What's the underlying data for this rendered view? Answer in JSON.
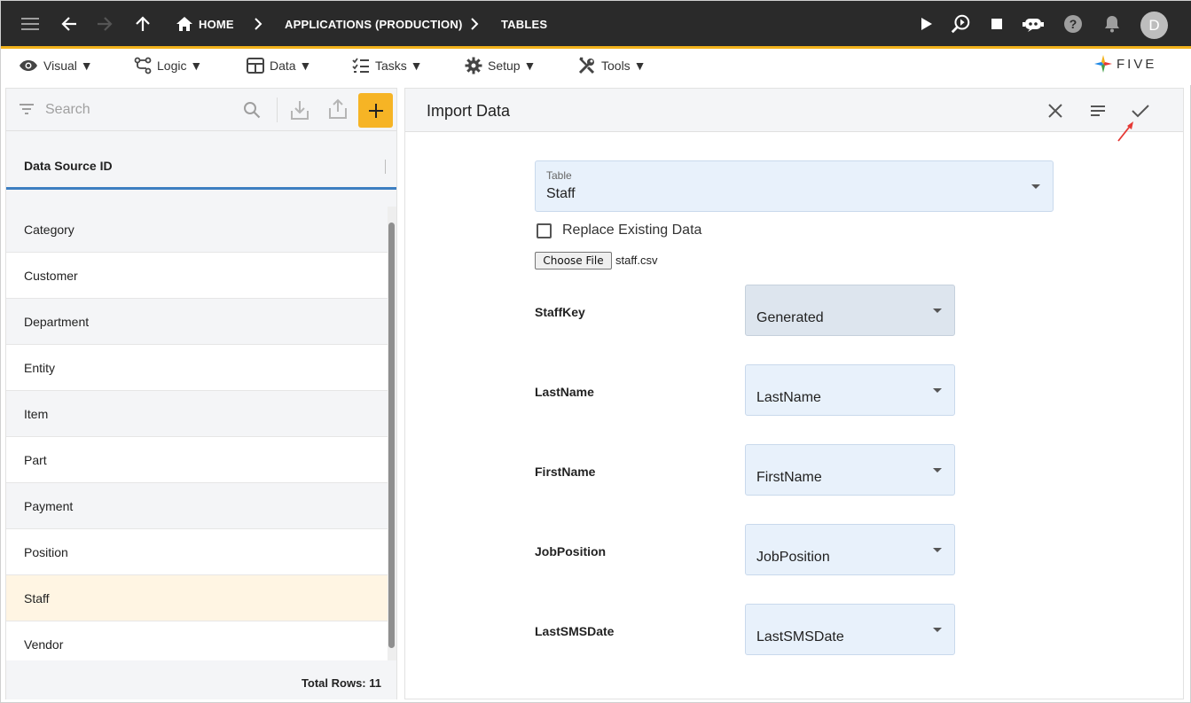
{
  "topbar": {
    "breadcrumbs": [
      "HOME",
      "APPLICATIONS (PRODUCTION)",
      "TABLES"
    ],
    "avatar_letter": "D"
  },
  "menu": {
    "items": [
      {
        "label": "Visual ▼",
        "icon": "eye-icon"
      },
      {
        "label": "Logic ▼",
        "icon": "logic-icon"
      },
      {
        "label": "Data ▼",
        "icon": "table-icon"
      },
      {
        "label": "Tasks ▼",
        "icon": "tasks-icon"
      },
      {
        "label": "Setup ▼",
        "icon": "gear-icon"
      },
      {
        "label": "Tools ▼",
        "icon": "tools-icon"
      }
    ],
    "logo_text": "FIVE"
  },
  "left_panel": {
    "search_placeholder": "Search",
    "column_header": "Data Source ID",
    "items": [
      "Category",
      "Customer",
      "Department",
      "Entity",
      "Item",
      "Part",
      "Payment",
      "Position",
      "Staff",
      "Vendor"
    ],
    "selected": "Staff",
    "total_rows": "Total Rows: 11"
  },
  "import": {
    "title": "Import Data",
    "table_label": "Table",
    "table_value": "Staff",
    "replace_label": "Replace Existing Data",
    "choose_file_label": "Choose File",
    "file_name": "staff.csv",
    "mappings": [
      {
        "field": "StaffKey",
        "value": "Generated"
      },
      {
        "field": "LastName",
        "value": "LastName"
      },
      {
        "field": "FirstName",
        "value": "FirstName"
      },
      {
        "field": "JobPosition",
        "value": "JobPosition"
      },
      {
        "field": "LastSMSDate",
        "value": "LastSMSDate"
      }
    ]
  },
  "colors": {
    "topbar_bg": "#2a2a2a",
    "accent": "#f2b21b",
    "selected_row": "#fff5e3",
    "select_bg": "#e8f1fb",
    "header_underline": "#3d7fc1"
  }
}
